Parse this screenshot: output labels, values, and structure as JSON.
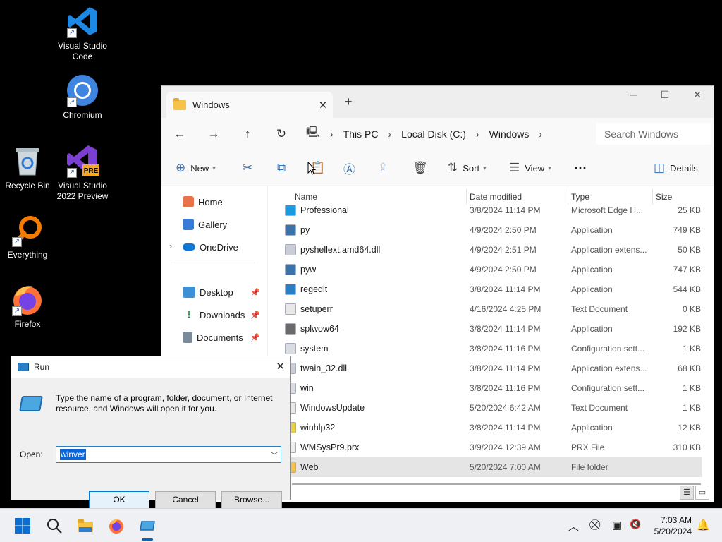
{
  "desktop": {
    "icons": [
      {
        "label": "Visual Studio Code",
        "icon": "vscode-icon"
      },
      {
        "label": "Chromium",
        "icon": "chromium-icon"
      },
      {
        "label": "Recycle Bin",
        "icon": "recycle-bin-icon"
      },
      {
        "label": "Visual Studio 2022 Preview",
        "icon": "visual-studio-icon"
      },
      {
        "label": "Everything",
        "icon": "everything-icon"
      },
      {
        "label": "Firefox",
        "icon": "firefox-icon"
      }
    ]
  },
  "explorer": {
    "tab_title": "Windows",
    "breadcrumb": [
      "This PC",
      "Local Disk (C:)",
      "Windows"
    ],
    "search_placeholder": "Search Windows",
    "toolbar": {
      "new": "New",
      "sort": "Sort",
      "view": "View",
      "details": "Details"
    },
    "sidebar": {
      "home": "Home",
      "gallery": "Gallery",
      "onedrive": "OneDrive",
      "desktop": "Desktop",
      "downloads": "Downloads",
      "documents": "Documents"
    },
    "columns": {
      "name": "Name",
      "date": "Date modified",
      "type": "Type",
      "size": "Size"
    },
    "files": [
      {
        "name": "Professional",
        "date": "3/8/2024 11:14 PM",
        "type": "Microsoft Edge H...",
        "size": "25 KB",
        "icon": "edge-html-icon"
      },
      {
        "name": "py",
        "date": "4/9/2024 2:50 PM",
        "type": "Application",
        "size": "749 KB",
        "icon": "python-icon"
      },
      {
        "name": "pyshellext.amd64.dll",
        "date": "4/9/2024 2:51 PM",
        "type": "Application extens...",
        "size": "50 KB",
        "icon": "dll-icon"
      },
      {
        "name": "pyw",
        "date": "4/9/2024 2:50 PM",
        "type": "Application",
        "size": "747 KB",
        "icon": "python-icon"
      },
      {
        "name": "regedit",
        "date": "3/8/2024 11:14 PM",
        "type": "Application",
        "size": "544 KB",
        "icon": "regedit-icon"
      },
      {
        "name": "setuperr",
        "date": "4/16/2024 4:25 PM",
        "type": "Text Document",
        "size": "0 KB",
        "icon": "text-file-icon"
      },
      {
        "name": "splwow64",
        "date": "3/8/2024 11:14 PM",
        "type": "Application",
        "size": "192 KB",
        "icon": "printer-icon"
      },
      {
        "name": "system",
        "date": "3/8/2024 11:16 PM",
        "type": "Configuration sett...",
        "size": "1 KB",
        "icon": "config-file-icon"
      },
      {
        "name": "twain_32.dll",
        "date": "3/8/2024 11:14 PM",
        "type": "Application extens...",
        "size": "68 KB",
        "icon": "dll-icon"
      },
      {
        "name": "win",
        "date": "3/8/2024 11:16 PM",
        "type": "Configuration sett...",
        "size": "1 KB",
        "icon": "config-file-icon"
      },
      {
        "name": "WindowsUpdate",
        "date": "5/20/2024 6:42 AM",
        "type": "Text Document",
        "size": "1 KB",
        "icon": "text-file-icon"
      },
      {
        "name": "winhlp32",
        "date": "3/8/2024 11:14 PM",
        "type": "Application",
        "size": "12 KB",
        "icon": "help-icon"
      },
      {
        "name": "WMSysPr9.prx",
        "date": "3/9/2024 12:39 AM",
        "type": "PRX File",
        "size": "310 KB",
        "icon": "file-icon"
      },
      {
        "name": "Web",
        "date": "5/20/2024 7:00 AM",
        "type": "File folder",
        "size": "",
        "icon": "folder-icon"
      }
    ]
  },
  "run_dialog": {
    "title": "Run",
    "message": "Type the name of a program, folder, document, or Internet resource, and Windows will open it for you.",
    "open_label": "Open:",
    "input_value": "winver",
    "ok": "OK",
    "cancel": "Cancel",
    "browse": "Browse..."
  },
  "taskbar": {
    "time": "7:03 AM",
    "date": "5/20/2024"
  },
  "colors": {
    "accent": "#0067c0",
    "folder": "#f5c345",
    "selection": "#e5e5e5"
  }
}
